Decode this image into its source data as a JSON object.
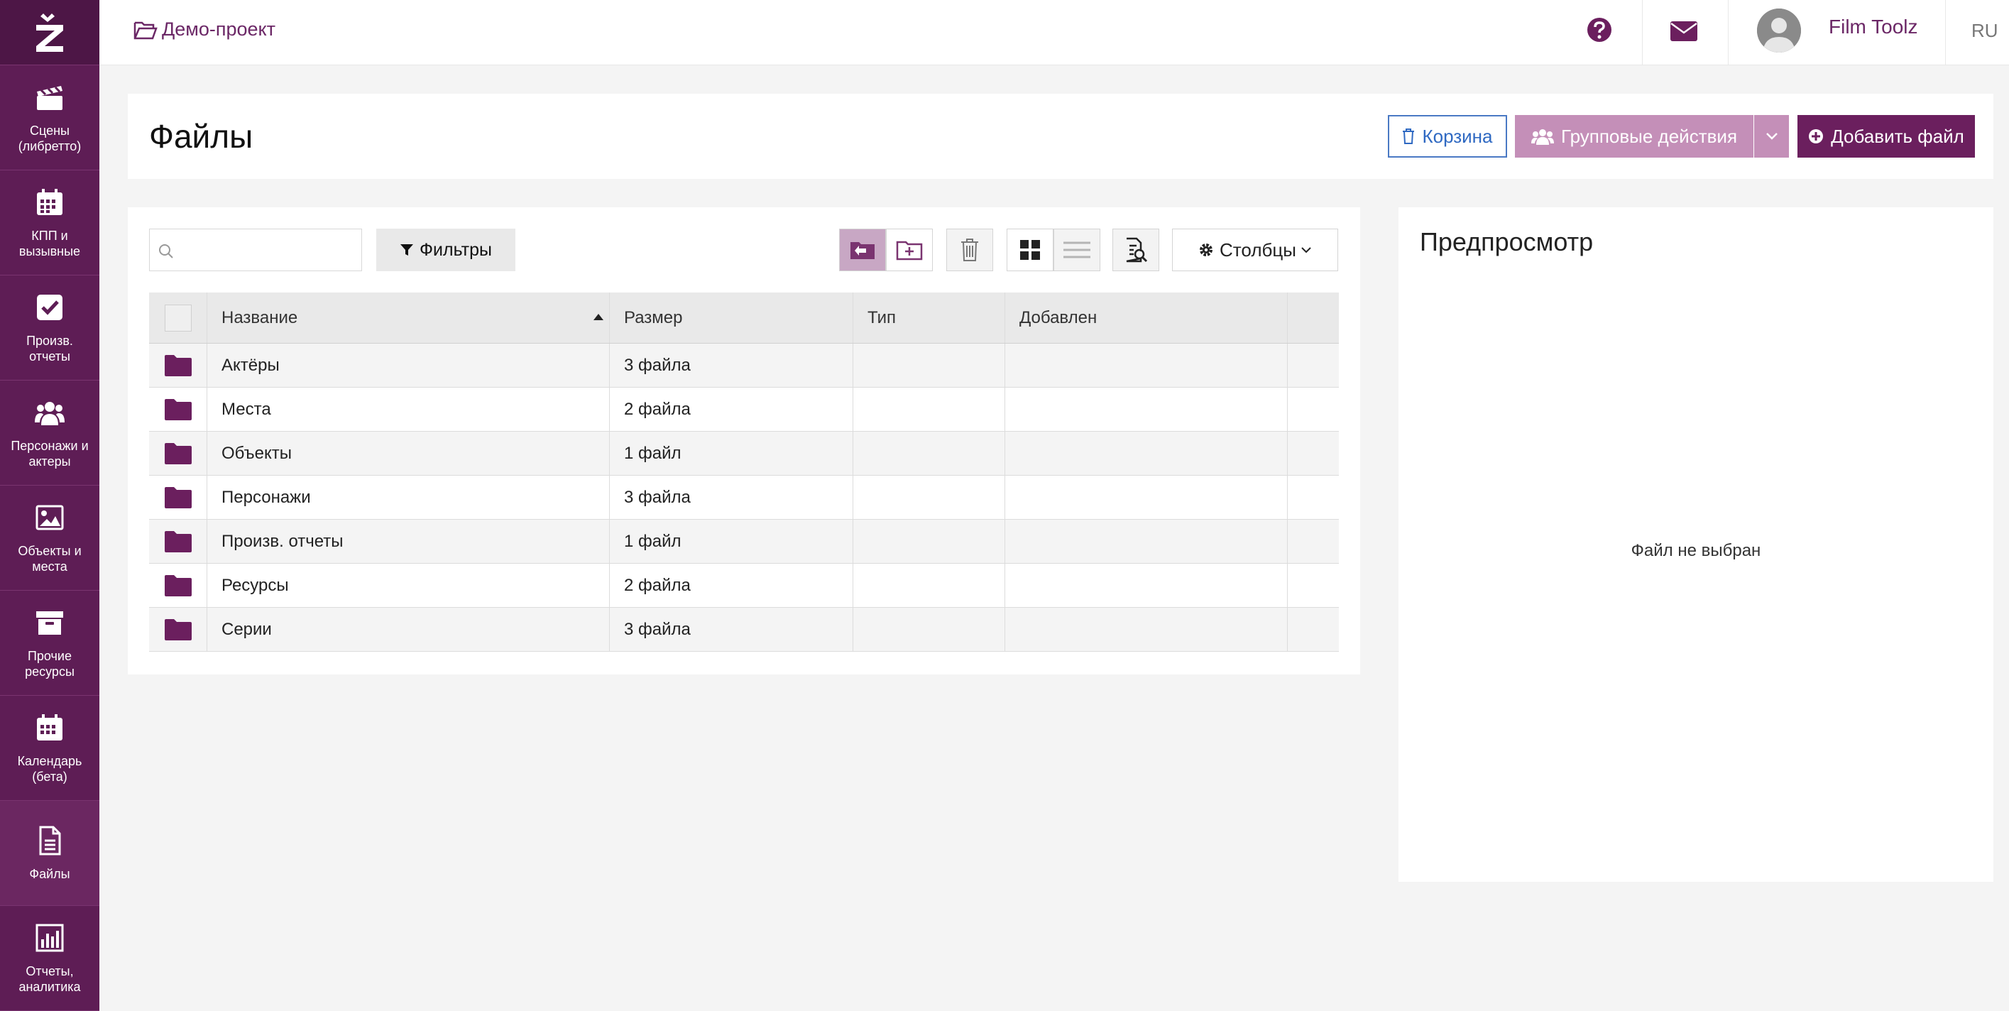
{
  "sidebar": {
    "items": [
      {
        "label": "Сцены (либретто)",
        "icon": "clapperboard-icon"
      },
      {
        "label": "КПП и вызывные",
        "icon": "calendar-icon"
      },
      {
        "label": "Произв. отчеты",
        "icon": "checkbox-icon"
      },
      {
        "label": "Персонажи и актеры",
        "icon": "users-icon"
      },
      {
        "label": "Объекты и места",
        "icon": "image-icon"
      },
      {
        "label": "Прочие ресурсы",
        "icon": "archive-box-icon"
      },
      {
        "label": "Календарь (бета)",
        "icon": "calendar-icon"
      },
      {
        "label": "Файлы",
        "icon": "file-icon"
      },
      {
        "label": "Отчеты, аналитика",
        "icon": "bar-chart-icon"
      }
    ]
  },
  "topbar": {
    "project": "Демо-проект",
    "user": "Film Toolz",
    "lang": "RU"
  },
  "header": {
    "title": "Файлы",
    "trash_label": "Корзина",
    "group_label": "Групповые действия",
    "add_label": "Добавить файл"
  },
  "toolbar": {
    "search_placeholder": "",
    "filters_label": "Фильтры",
    "columns_label": "Столбцы"
  },
  "table": {
    "columns": [
      "Название",
      "Размер",
      "Тип",
      "Добавлен"
    ],
    "rows": [
      {
        "name": "Актёры",
        "size": "3 файла",
        "type": "",
        "added": ""
      },
      {
        "name": "Места",
        "size": "2 файла",
        "type": "",
        "added": ""
      },
      {
        "name": "Объекты",
        "size": "1 файл",
        "type": "",
        "added": ""
      },
      {
        "name": "Персонажи",
        "size": "3 файла",
        "type": "",
        "added": ""
      },
      {
        "name": "Произв. отчеты",
        "size": "1 файл",
        "type": "",
        "added": ""
      },
      {
        "name": "Ресурсы",
        "size": "2 файла",
        "type": "",
        "added": ""
      },
      {
        "name": "Серии",
        "size": "3 файла",
        "type": "",
        "added": ""
      }
    ]
  },
  "preview": {
    "title": "Предпросмотр",
    "empty": "Файл не выбран"
  },
  "colors": {
    "brand": "#5e1d55",
    "accent": "#6b1f5e",
    "folder": "#6b1f5e",
    "muted_accent": "#c48fb8",
    "link_blue": "#2f69c2"
  }
}
